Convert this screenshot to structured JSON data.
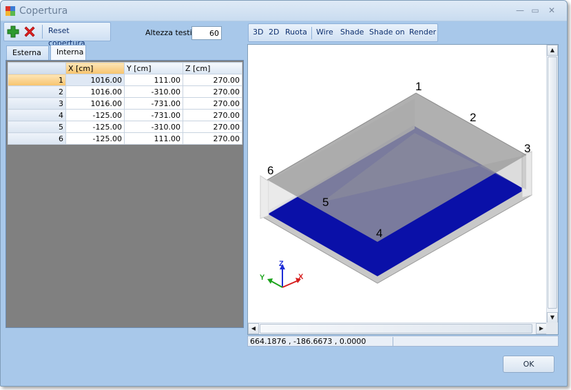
{
  "window": {
    "title": "Copertura"
  },
  "toolbar": {
    "reset_label": "Reset copertura"
  },
  "altezza": {
    "label": "Altezza testi",
    "value": "60"
  },
  "tabs": [
    {
      "label": "Esterna",
      "active": false
    },
    {
      "label": "Interna",
      "active": true
    }
  ],
  "grid": {
    "columns": [
      "X [cm]",
      "Y [cm]",
      "Z [cm]"
    ],
    "rows": [
      {
        "n": "1",
        "x": "1016.00",
        "y": "111.00",
        "z": "270.00"
      },
      {
        "n": "2",
        "x": "1016.00",
        "y": "-310.00",
        "z": "270.00"
      },
      {
        "n": "3",
        "x": "1016.00",
        "y": "-731.00",
        "z": "270.00"
      },
      {
        "n": "4",
        "x": "-125.00",
        "y": "-731.00",
        "z": "270.00"
      },
      {
        "n": "5",
        "x": "-125.00",
        "y": "-310.00",
        "z": "270.00"
      },
      {
        "n": "6",
        "x": "-125.00",
        "y": "111.00",
        "z": "270.00"
      }
    ]
  },
  "view_toolbar": {
    "b3d": "3D",
    "b2d": "2D",
    "ruota": "Ruota",
    "wire": "Wire",
    "shade": "Shade",
    "shade_on": "Shade on",
    "render": "Render"
  },
  "viewport": {
    "point_labels": [
      "1",
      "2",
      "3",
      "4",
      "5",
      "6"
    ],
    "axes": {
      "x": "X",
      "y": "Y",
      "z": "Z"
    },
    "colors": {
      "floor": "#0a10a8",
      "roof": "#9a9a9a",
      "wall": "#e4e4e4"
    }
  },
  "status": {
    "coords": "664.1876 , -186.6673 , 0.0000"
  },
  "ok_label": "OK"
}
